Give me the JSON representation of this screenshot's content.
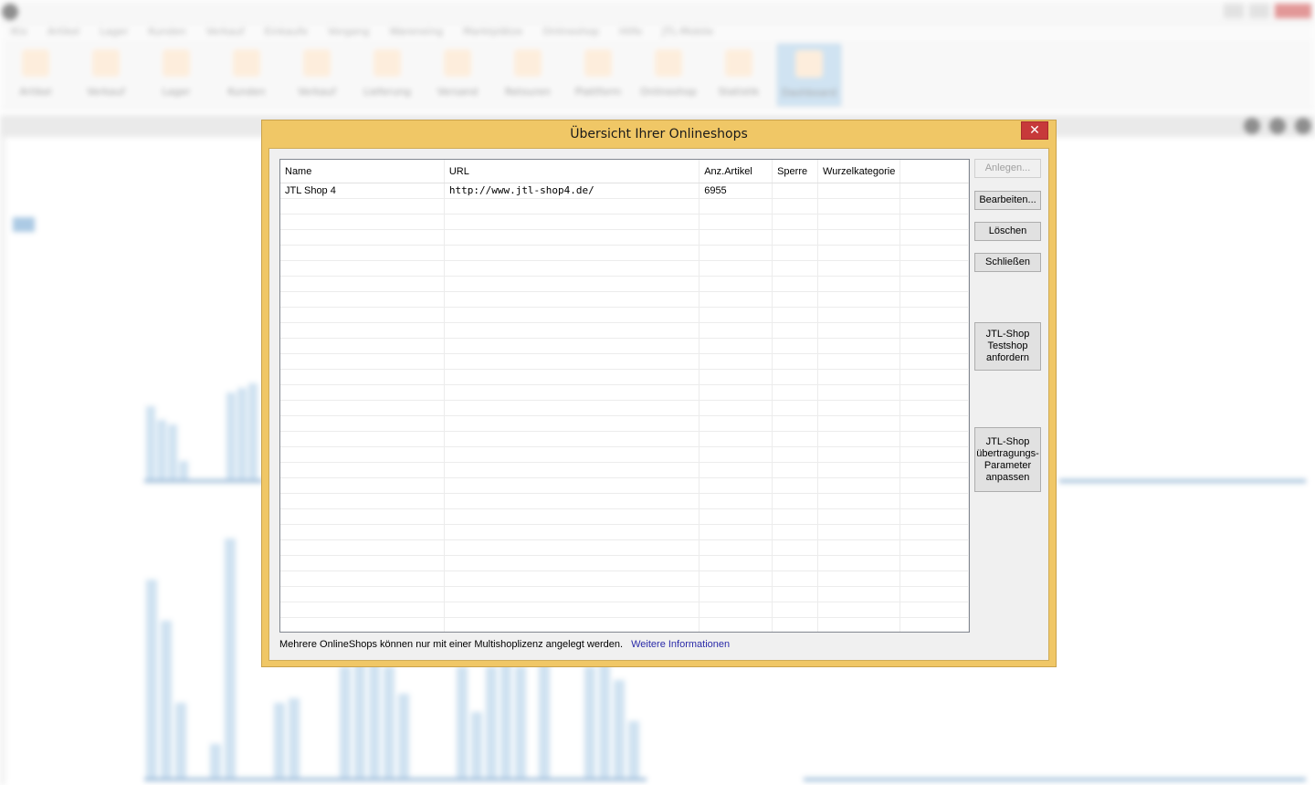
{
  "background": {
    "menu_items": [
      "Ktx",
      "Artikel",
      "Lager",
      "Kunden",
      "Verkauf",
      "Einkaufe",
      "Vorgang",
      "Wareneing",
      "Marktplätze",
      "Onlineshop",
      "Hilfe",
      "JTL-Mobile"
    ],
    "ribbon_buttons": [
      "Artikel",
      "Verkauf",
      "Lager",
      "Kunden",
      "Verkauf",
      "Lieferung",
      "Versand",
      "Retouren",
      "Plattform",
      "Onlineshop",
      "Statistik",
      "Dashboard"
    ],
    "active_ribbon": 11
  },
  "dialog": {
    "title": "Übersicht Ihrer Onlineshops",
    "close_glyph": "✕",
    "grid": {
      "columns": [
        "Name",
        "URL",
        "Anz.Artikel",
        "Sperre",
        "Wurzelkategorie",
        ""
      ],
      "rows": [
        [
          "JTL Shop 4",
          "http://www.jtl-shop4.de/",
          "6955",
          "",
          "",
          ""
        ]
      ],
      "empty_row_count": 28
    },
    "buttons": {
      "anlegen": "Anlegen...",
      "bearbeiten": "Bearbeiten...",
      "loeschen": "Löschen",
      "schliessen": "Schließen",
      "testshop": "JTL-Shop Testshop anfordern",
      "parameter": "JTL-Shop übertragungs-Parameter anpassen"
    },
    "footer": {
      "text": "Mehrere OnlineShops können nur mit einer Multishoplizenz angelegt werden.",
      "link": "Weitere Informationen"
    }
  },
  "colors": {
    "dialog_frame": "#f0c766",
    "close_button": "#c7393a",
    "link": "#2a2aa8"
  }
}
